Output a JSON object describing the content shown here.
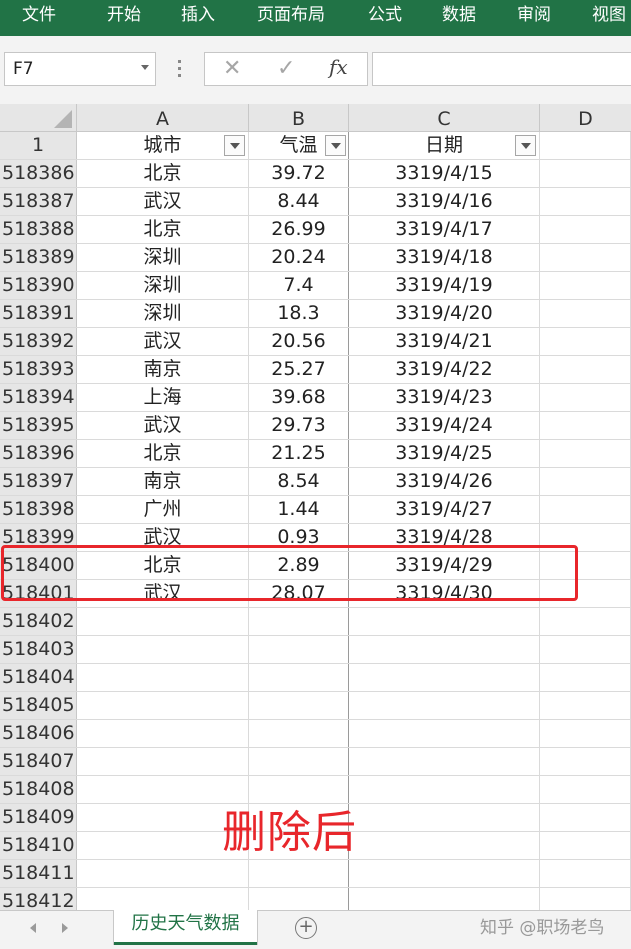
{
  "ribbon": {
    "tabs": [
      {
        "label": "文件"
      },
      {
        "label": "开始"
      },
      {
        "label": "插入"
      },
      {
        "label": "页面布局"
      },
      {
        "label": "公式"
      },
      {
        "label": "数据"
      },
      {
        "label": "审阅"
      },
      {
        "label": "视图"
      }
    ]
  },
  "formula_bar": {
    "name_box": "F7",
    "cancel_icon": "✕",
    "enter_icon": "✓",
    "fx_label": "fx",
    "formula": ""
  },
  "columns": [
    "A",
    "B",
    "C",
    "D"
  ],
  "header_row": {
    "row_number": "1",
    "city": "城市",
    "temp": "气温",
    "date": "日期"
  },
  "rows": [
    {
      "n": "518386",
      "city": "北京",
      "temp": "39.72",
      "date": "3319/4/15"
    },
    {
      "n": "518387",
      "city": "武汉",
      "temp": "8.44",
      "date": "3319/4/16"
    },
    {
      "n": "518388",
      "city": "北京",
      "temp": "26.99",
      "date": "3319/4/17"
    },
    {
      "n": "518389",
      "city": "深圳",
      "temp": "20.24",
      "date": "3319/4/18"
    },
    {
      "n": "518390",
      "city": "深圳",
      "temp": "7.4",
      "date": "3319/4/19"
    },
    {
      "n": "518391",
      "city": "深圳",
      "temp": "18.3",
      "date": "3319/4/20"
    },
    {
      "n": "518392",
      "city": "武汉",
      "temp": "20.56",
      "date": "3319/4/21"
    },
    {
      "n": "518393",
      "city": "南京",
      "temp": "25.27",
      "date": "3319/4/22"
    },
    {
      "n": "518394",
      "city": "上海",
      "temp": "39.68",
      "date": "3319/4/23"
    },
    {
      "n": "518395",
      "city": "武汉",
      "temp": "29.73",
      "date": "3319/4/24"
    },
    {
      "n": "518396",
      "city": "北京",
      "temp": "21.25",
      "date": "3319/4/25"
    },
    {
      "n": "518397",
      "city": "南京",
      "temp": "8.54",
      "date": "3319/4/26"
    },
    {
      "n": "518398",
      "city": "广州",
      "temp": "1.44",
      "date": "3319/4/27"
    },
    {
      "n": "518399",
      "city": "武汉",
      "temp": "0.93",
      "date": "3319/4/28"
    },
    {
      "n": "518400",
      "city": "北京",
      "temp": "2.89",
      "date": "3319/4/29"
    },
    {
      "n": "518401",
      "city": "武汉",
      "temp": "28.07",
      "date": "3319/4/30"
    },
    {
      "n": "518402",
      "city": "",
      "temp": "",
      "date": ""
    },
    {
      "n": "518403",
      "city": "",
      "temp": "",
      "date": ""
    },
    {
      "n": "518404",
      "city": "",
      "temp": "",
      "date": ""
    },
    {
      "n": "518405",
      "city": "",
      "temp": "",
      "date": ""
    },
    {
      "n": "518406",
      "city": "",
      "temp": "",
      "date": ""
    },
    {
      "n": "518407",
      "city": "",
      "temp": "",
      "date": ""
    },
    {
      "n": "518408",
      "city": "",
      "temp": "",
      "date": ""
    },
    {
      "n": "518409",
      "city": "",
      "temp": "",
      "date": ""
    },
    {
      "n": "518410",
      "city": "",
      "temp": "",
      "date": ""
    },
    {
      "n": "518411",
      "city": "",
      "temp": "",
      "date": ""
    },
    {
      "n": "518412",
      "city": "",
      "temp": "",
      "date": ""
    }
  ],
  "annotation": "删除后",
  "sheet_tabs": {
    "active": "历史天气数据",
    "add_icon": "+"
  },
  "watermark": "知乎 @职场老鸟",
  "colors": {
    "ribbon": "#217346",
    "highlight": "#e8262b"
  }
}
